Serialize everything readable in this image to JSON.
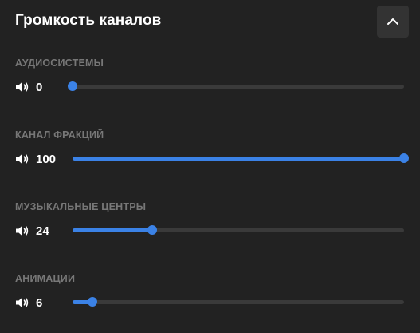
{
  "panel": {
    "title": "Громкость каналов",
    "collapse_icon": "chevron-up-icon"
  },
  "channels": [
    {
      "label": "АУДИОСИСТЕМЫ",
      "value": 0,
      "value_text": "0",
      "max": 100,
      "icon": "speaker-icon"
    },
    {
      "label": "КАНАЛ ФРАКЦИЙ",
      "value": 100,
      "value_text": "100",
      "max": 100,
      "icon": "speaker-icon"
    },
    {
      "label": "МУЗЫКАЛЬНЫЕ ЦЕНТРЫ",
      "value": 24,
      "value_text": "24",
      "max": 100,
      "icon": "speaker-icon"
    },
    {
      "label": "АНИМАЦИИ",
      "value": 6,
      "value_text": "6",
      "max": 100,
      "icon": "speaker-icon"
    }
  ],
  "colors": {
    "background": "#222222",
    "accent": "#3b82e6",
    "track": "#3a3a3a",
    "label": "#777777"
  }
}
